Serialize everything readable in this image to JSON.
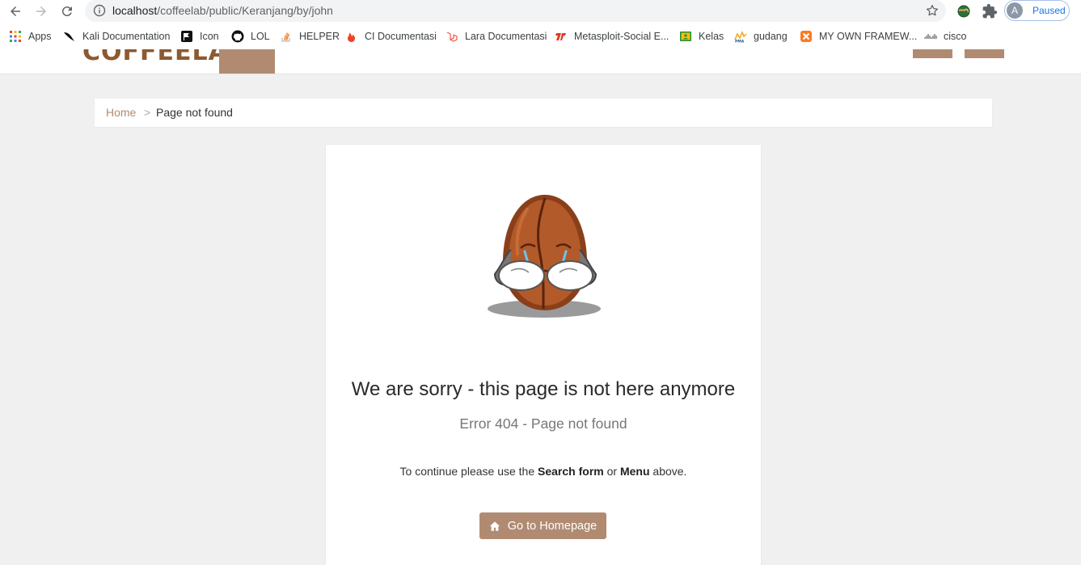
{
  "browser": {
    "url_host": "localhost",
    "url_path": "/coffeelab/public/Keranjang/by/john",
    "profile_initial": "A",
    "profile_status": "Paused"
  },
  "bookmarks": [
    {
      "label": "Apps",
      "icon": "apps-grid-icon"
    },
    {
      "label": "Kali Documentation",
      "icon": "kali-dragon-icon"
    },
    {
      "label": "Icon",
      "icon": "flag-icon"
    },
    {
      "label": "LOL",
      "icon": "github-icon"
    },
    {
      "label": "HELPER",
      "icon": "stackoverflow-icon"
    },
    {
      "label": "CI Documentasi",
      "icon": "codeigniter-flame-icon"
    },
    {
      "label": "Lara Documentasi",
      "icon": "laravel-icon"
    },
    {
      "label": "Metasploit-Social E...",
      "icon": "metasploit-icon"
    },
    {
      "label": "Kelas",
      "icon": "classroom-icon"
    },
    {
      "label": "gudang",
      "icon": "phpmyadmin-icon"
    },
    {
      "label": "MY OWN FRAMEW...",
      "icon": "xampp-icon"
    },
    {
      "label": "cisco",
      "icon": "cisco-icon"
    }
  ],
  "site": {
    "logo_text": "COFFEELAB"
  },
  "breadcrumb": {
    "home": "Home",
    "separator": ">",
    "current": "Page not found"
  },
  "error": {
    "title": "We are sorry - this page is not here anymore",
    "subtitle": "Error 404 - Page not found",
    "hint_prefix": "To continue please use the",
    "hint_search": "Search form",
    "hint_or": "or",
    "hint_menu": "Menu",
    "hint_suffix": "above.",
    "button_label": "Go to Homepage"
  },
  "colors": {
    "accent": "#b08b72",
    "logo": "#8c5a30",
    "background": "#f0f0f0"
  }
}
